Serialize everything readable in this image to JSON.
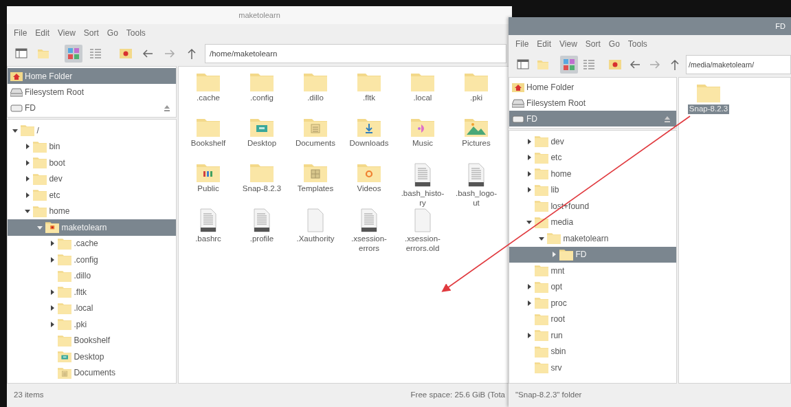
{
  "windows": [
    {
      "title": "maketolearn",
      "active": false,
      "tree_root_hidden": false,
      "menu": [
        "File",
        "Edit",
        "View",
        "Sort",
        "Go",
        "Tools"
      ],
      "icon_view": true,
      "path": "/home/maketolearn",
      "places": [
        {
          "label": "Home Folder",
          "kind": "home",
          "selected": true,
          "eject": false
        },
        {
          "label": "Filesystem Root",
          "kind": "drive",
          "selected": false,
          "eject": false
        },
        {
          "label": "FD",
          "kind": "usb",
          "selected": false,
          "eject": true
        }
      ],
      "tree": [
        {
          "label": "/",
          "kind": "folder",
          "expandable": true,
          "expanded": true,
          "selected": false,
          "children": [
            {
              "label": "bin",
              "kind": "folder",
              "expandable": true,
              "expanded": false,
              "selected": false
            },
            {
              "label": "boot",
              "kind": "folder",
              "expandable": true,
              "expanded": false,
              "selected": false
            },
            {
              "label": "dev",
              "kind": "folder",
              "expandable": true,
              "expanded": false,
              "selected": false
            },
            {
              "label": "etc",
              "kind": "folder",
              "expandable": true,
              "expanded": false,
              "selected": false
            },
            {
              "label": "home",
              "kind": "folder",
              "expandable": true,
              "expanded": true,
              "selected": false,
              "children": [
                {
                  "label": "maketolearn",
                  "kind": "home",
                  "expandable": true,
                  "expanded": true,
                  "selected": true,
                  "children": [
                    {
                      "label": ".cache",
                      "kind": "folder",
                      "expandable": true,
                      "expanded": false,
                      "selected": false
                    },
                    {
                      "label": ".config",
                      "kind": "folder",
                      "expandable": true,
                      "expanded": false,
                      "selected": false
                    },
                    {
                      "label": ".dillo",
                      "kind": "folder",
                      "expandable": false,
                      "expanded": false,
                      "selected": false
                    },
                    {
                      "label": ".fltk",
                      "kind": "folder",
                      "expandable": true,
                      "expanded": false,
                      "selected": false
                    },
                    {
                      "label": ".local",
                      "kind": "folder",
                      "expandable": true,
                      "expanded": false,
                      "selected": false
                    },
                    {
                      "label": ".pki",
                      "kind": "folder",
                      "expandable": true,
                      "expanded": false,
                      "selected": false
                    },
                    {
                      "label": "Bookshelf",
                      "kind": "folder",
                      "expandable": false,
                      "expanded": false,
                      "selected": false
                    },
                    {
                      "label": "Desktop",
                      "kind": "desktop",
                      "expandable": false,
                      "expanded": false,
                      "selected": false
                    },
                    {
                      "label": "Documents",
                      "kind": "documents",
                      "expandable": false,
                      "expanded": false,
                      "selected": false
                    }
                  ]
                }
              ]
            }
          ]
        }
      ],
      "files": [
        {
          "label": ".cache",
          "kind": "folder",
          "selected": false
        },
        {
          "label": ".config",
          "kind": "folder",
          "selected": false
        },
        {
          "label": ".dillo",
          "kind": "folder",
          "selected": false
        },
        {
          "label": ".fltk",
          "kind": "folder",
          "selected": false
        },
        {
          "label": ".local",
          "kind": "folder",
          "selected": false
        },
        {
          "label": ".pki",
          "kind": "folder",
          "selected": false
        },
        {
          "label": "Bookshelf",
          "kind": "folder",
          "selected": false
        },
        {
          "label": "Desktop",
          "kind": "desktop",
          "selected": false
        },
        {
          "label": "Documents",
          "kind": "documents",
          "selected": false
        },
        {
          "label": "Downloads",
          "kind": "downloads",
          "selected": false
        },
        {
          "label": "Music",
          "kind": "music",
          "selected": false
        },
        {
          "label": "Pictures",
          "kind": "pictures",
          "selected": false
        },
        {
          "label": "Public",
          "kind": "public",
          "selected": false
        },
        {
          "label": "Snap-8.2.3",
          "kind": "folder",
          "selected": false
        },
        {
          "label": "Templates",
          "kind": "templates",
          "selected": false
        },
        {
          "label": "Videos",
          "kind": "videos",
          "selected": false
        },
        {
          "label": ".bash_histo-ry",
          "kind": "text",
          "selected": false
        },
        {
          "label": ".bash_logo-ut",
          "kind": "text",
          "selected": false
        },
        {
          "label": ".bashrc",
          "kind": "text",
          "selected": false
        },
        {
          "label": ".profile",
          "kind": "text",
          "selected": false
        },
        {
          "label": ".Xauthority",
          "kind": "blank",
          "selected": false
        },
        {
          "label": ".xsession-errors",
          "kind": "text",
          "selected": false
        },
        {
          "label": ".xsession-errors.old",
          "kind": "blank",
          "selected": false
        }
      ],
      "status": {
        "left": "23 items",
        "right": "Free space: 25.6 GiB (Tota"
      }
    },
    {
      "title": "FD",
      "active": true,
      "tree_root_hidden": true,
      "menu": [
        "File",
        "Edit",
        "View",
        "Sort",
        "Go",
        "Tools"
      ],
      "icon_view": true,
      "path": "/media/maketolearn/",
      "places": [
        {
          "label": "Home Folder",
          "kind": "home",
          "selected": false,
          "eject": false
        },
        {
          "label": "Filesystem Root",
          "kind": "drive",
          "selected": false,
          "eject": false
        },
        {
          "label": "FD",
          "kind": "usb",
          "selected": true,
          "eject": true
        }
      ],
      "tree": [
        {
          "label": "dev",
          "kind": "folder",
          "expandable": true,
          "expanded": false,
          "selected": false
        },
        {
          "label": "etc",
          "kind": "folder",
          "expandable": true,
          "expanded": false,
          "selected": false
        },
        {
          "label": "home",
          "kind": "folder",
          "expandable": true,
          "expanded": false,
          "selected": false
        },
        {
          "label": "lib",
          "kind": "folder",
          "expandable": true,
          "expanded": false,
          "selected": false
        },
        {
          "label": "lost+found",
          "kind": "folder",
          "expandable": false,
          "expanded": false,
          "selected": false
        },
        {
          "label": "media",
          "kind": "folder",
          "expandable": true,
          "expanded": true,
          "selected": false,
          "children": [
            {
              "label": "maketolearn",
              "kind": "folder",
              "expandable": true,
              "expanded": true,
              "selected": false,
              "children": [
                {
                  "label": "FD",
                  "kind": "folder",
                  "expandable": true,
                  "expanded": false,
                  "selected": true
                }
              ]
            }
          ]
        },
        {
          "label": "mnt",
          "kind": "folder",
          "expandable": false,
          "expanded": false,
          "selected": false
        },
        {
          "label": "opt",
          "kind": "folder",
          "expandable": true,
          "expanded": false,
          "selected": false
        },
        {
          "label": "proc",
          "kind": "folder",
          "expandable": true,
          "expanded": false,
          "selected": false
        },
        {
          "label": "root",
          "kind": "folder",
          "expandable": false,
          "expanded": false,
          "selected": false
        },
        {
          "label": "run",
          "kind": "folder",
          "expandable": true,
          "expanded": false,
          "selected": false
        },
        {
          "label": "sbin",
          "kind": "folder",
          "expandable": false,
          "expanded": false,
          "selected": false
        },
        {
          "label": "srv",
          "kind": "folder",
          "expandable": false,
          "expanded": false,
          "selected": false
        }
      ],
      "files": [
        {
          "label": "Snap-8.2.3",
          "kind": "folder",
          "selected": true
        }
      ],
      "status": {
        "left": "\"Snap-8.2.3\" folder"
      }
    }
  ]
}
